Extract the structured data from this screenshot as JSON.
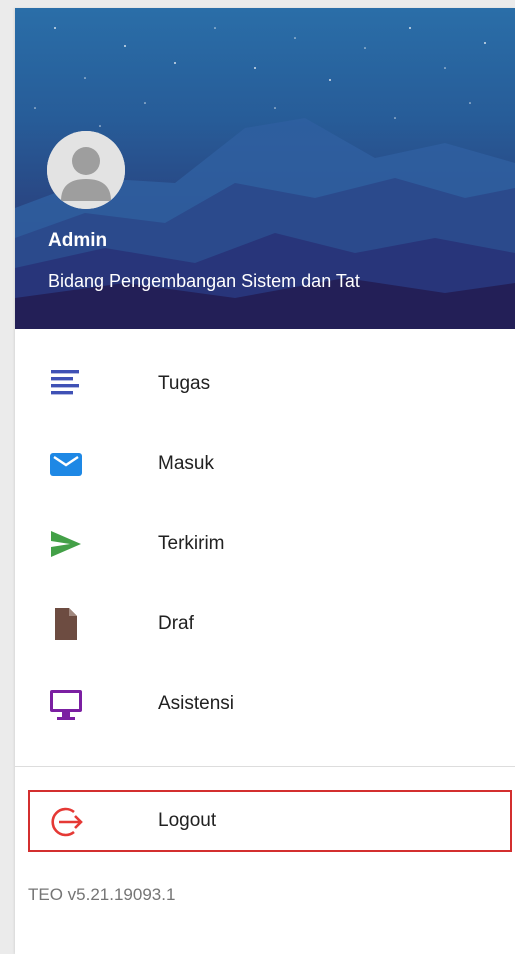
{
  "user": {
    "name": "Admin",
    "unit": "Bidang Pengembangan Sistem dan Tat",
    "avatar_icon": "person-avatar-icon"
  },
  "menu": {
    "items": [
      {
        "label": "Tugas",
        "icon": "list-lines-icon",
        "color": "#3f51b5"
      },
      {
        "label": "Masuk",
        "icon": "mail-icon",
        "color": "#1e88e5"
      },
      {
        "label": "Terkirim",
        "icon": "send-icon",
        "color": "#43a047"
      },
      {
        "label": "Draf",
        "icon": "document-icon",
        "color": "#6d4c41"
      },
      {
        "label": "Asistensi",
        "icon": "monitor-icon",
        "color": "#7b1fa2"
      }
    ]
  },
  "logout": {
    "label": "Logout",
    "icon": "logout-arrow-icon",
    "color": "#e53935",
    "highlight_color": "#d32f2f"
  },
  "footer": {
    "version": "TEO v5.21.19093.1"
  }
}
